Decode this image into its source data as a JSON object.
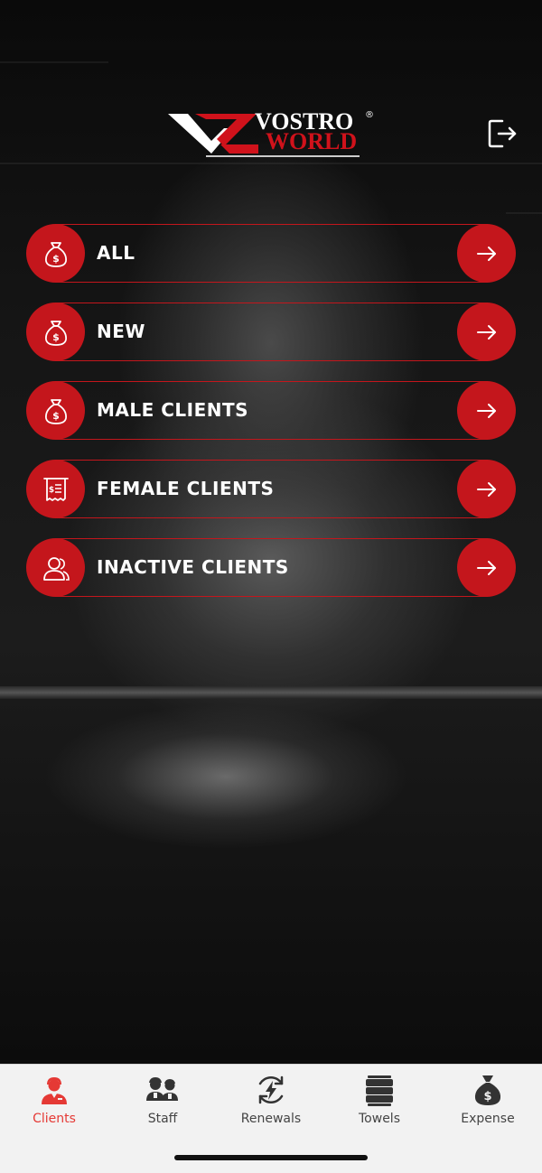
{
  "header": {
    "logo_top": "VOSTRO",
    "logo_bottom": "WORLD",
    "logo_reg": "®",
    "logout_icon": "logout-icon"
  },
  "menu": {
    "items": [
      {
        "label": "ALL",
        "icon": "money-bag-icon"
      },
      {
        "label": "NEW",
        "icon": "money-bag-icon"
      },
      {
        "label": "MALE CLIENTS",
        "icon": "money-bag-icon"
      },
      {
        "label": "FEMALE CLIENTS",
        "icon": "receipt-icon"
      },
      {
        "label": "INACTIVE CLIENTS",
        "icon": "users-icon"
      }
    ],
    "arrow_icon": "arrow-right-icon"
  },
  "tabbar": {
    "tabs": [
      {
        "label": "Clients",
        "icon": "client-icon",
        "active": true
      },
      {
        "label": "Staff",
        "icon": "staff-icon",
        "active": false
      },
      {
        "label": "Renewals",
        "icon": "renewals-icon",
        "active": false
      },
      {
        "label": "Towels",
        "icon": "towels-icon",
        "active": false
      },
      {
        "label": "Expense",
        "icon": "expense-bag-icon",
        "active": false
      }
    ]
  },
  "colors": {
    "accent": "#c4161c",
    "active_tab": "#e53935",
    "tab_text": "#444444",
    "tabbar_bg": "#f2f2f2"
  }
}
